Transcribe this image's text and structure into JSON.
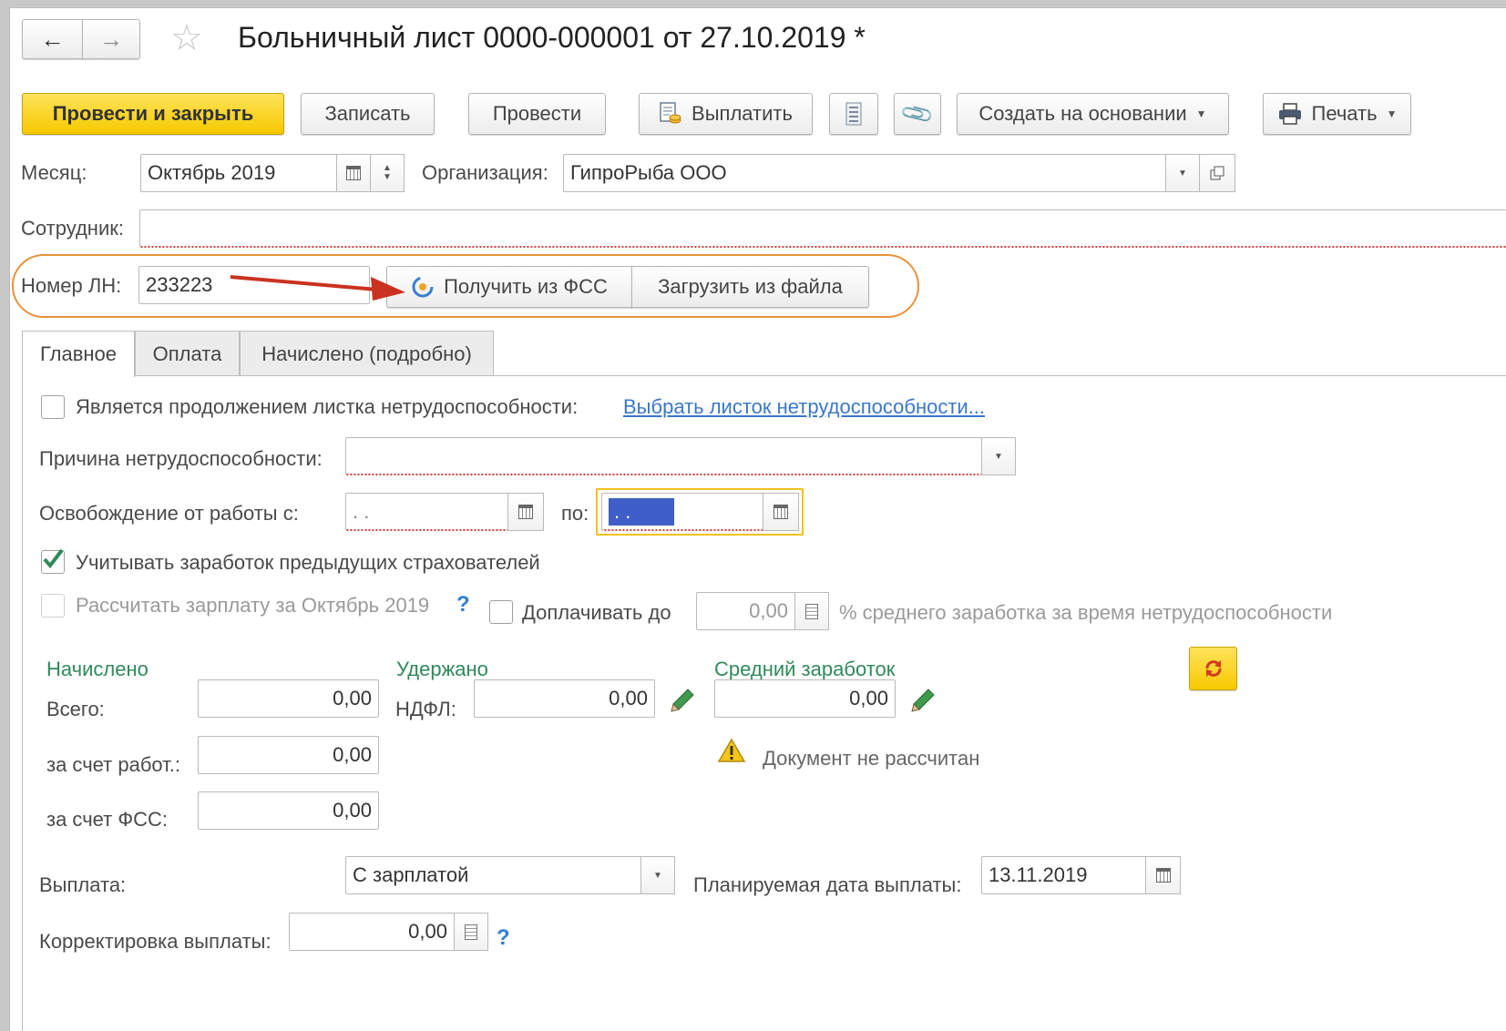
{
  "window": {
    "title": "Больничный лист 0000-000001 от 27.10.2019 *"
  },
  "toolbar": {
    "post_close": "Провести и закрыть",
    "save": "Записать",
    "post": "Провести",
    "pay": "Выплатить",
    "create_basis": "Создать на основании",
    "print": "Печать"
  },
  "header": {
    "month_label": "Месяц:",
    "month_value": "Октябрь 2019",
    "org_label": "Организация:",
    "org_value": "ГипроРыба ООО",
    "employee_label": "Сотрудник:",
    "employee_value": "",
    "ln_label": "Номер ЛН:",
    "ln_value": "233223",
    "get_fss": "Получить из ФСС",
    "load_file": "Загрузить из файла"
  },
  "tabs": [
    {
      "label": "Главное",
      "active": true
    },
    {
      "label": "Оплата",
      "active": false
    },
    {
      "label": "Начислено (подробно)",
      "active": false
    }
  ],
  "main": {
    "continuation_label": "Является продолжением листка нетрудоспособности:",
    "continuation_link": "Выбрать листок нетрудоспособности...",
    "continuation_checked": false,
    "reason_label": "Причина нетрудоспособности:",
    "reason_value": "",
    "release_label": "Освобождение от работы с:",
    "release_from": " .  .",
    "release_to_label": "по:",
    "release_to": " .  .",
    "prev_insurers_label": "Учитывать заработок предыдущих страхователей",
    "prev_insurers_checked": true,
    "calc_salary_label": "Рассчитать зарплату за Октябрь 2019",
    "calc_salary_help": "?",
    "calc_salary_checked": false,
    "topup_label": "Доплачивать до",
    "topup_checked": false,
    "topup_value": "0,00",
    "topup_suffix": "% среднего заработка за время нетрудоспособности"
  },
  "accrued": {
    "heading": "Начислено",
    "total_label": "Всего:",
    "total_value": "0,00",
    "employer_label": "за счет работ.:",
    "employer_value": "0,00",
    "fss_label": "за счет ФСС:",
    "fss_value": "0,00"
  },
  "withheld": {
    "heading": "Удержано",
    "ndfl_label": "НДФЛ:",
    "ndfl_value": "0,00"
  },
  "average": {
    "heading": "Средний заработок",
    "value": "0,00",
    "warning": "Документ не рассчитан"
  },
  "payment": {
    "label": "Выплата:",
    "value": "С зарплатой",
    "planned_label": "Планируемая дата выплаты:",
    "planned_value": "13.11.2019",
    "correction_label": "Корректировка выплаты:",
    "correction_value": "0,00",
    "correction_help": "?"
  },
  "colors": {
    "primary_button": "#f6c900",
    "highlight_oval": "#e8923a",
    "arrow": "#c9321e",
    "heading_green": "#2f8a5b",
    "link_blue": "#3a78c9"
  }
}
